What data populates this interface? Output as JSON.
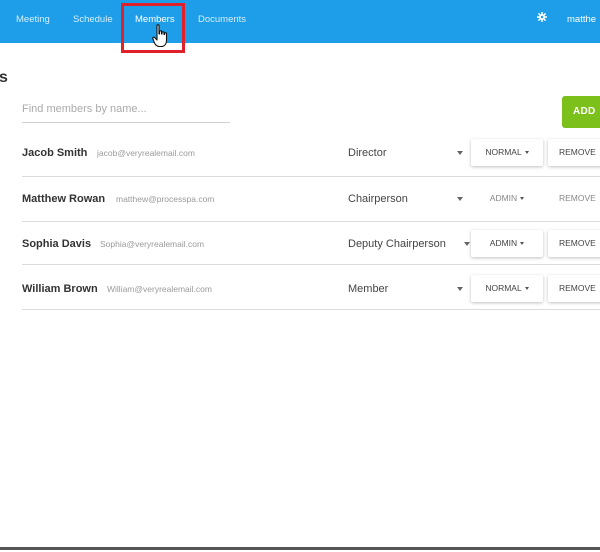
{
  "nav": {
    "items": [
      {
        "label": "Meeting",
        "active": false
      },
      {
        "label": "Schedule",
        "active": false
      },
      {
        "label": "Members",
        "active": true
      },
      {
        "label": "Documents",
        "active": false
      }
    ],
    "user_label": "matthe"
  },
  "page": {
    "title_fragment": "s"
  },
  "search": {
    "placeholder": "Find members by name..."
  },
  "add_button": {
    "label": "ADD"
  },
  "members": [
    {
      "name": "Jacob Smith",
      "email": "jacob@veryrealemail.com",
      "role": "Director",
      "access": "NORMAL",
      "remove_label": "REMOVE"
    },
    {
      "name": "Matthew Rowan",
      "email": "matthew@processpa.com",
      "role": "Chairperson",
      "access": "ADMIN",
      "remove_label": "REMOVE"
    },
    {
      "name": "Sophia Davis",
      "email": "Sophia@veryrealemail.com",
      "role": "Deputy Chairperson",
      "access": "ADMIN",
      "remove_label": "REMOVE"
    },
    {
      "name": "William Brown",
      "email": "William@veryrealemail.com",
      "role": "Member",
      "access": "NORMAL",
      "remove_label": "REMOVE"
    }
  ],
  "colors": {
    "topbar": "#1e9ee8",
    "add_button": "#7cc11b",
    "highlight": "#e0202a"
  },
  "icons": {
    "settings": "gear-icon",
    "pointer": "hand-cursor-icon"
  }
}
